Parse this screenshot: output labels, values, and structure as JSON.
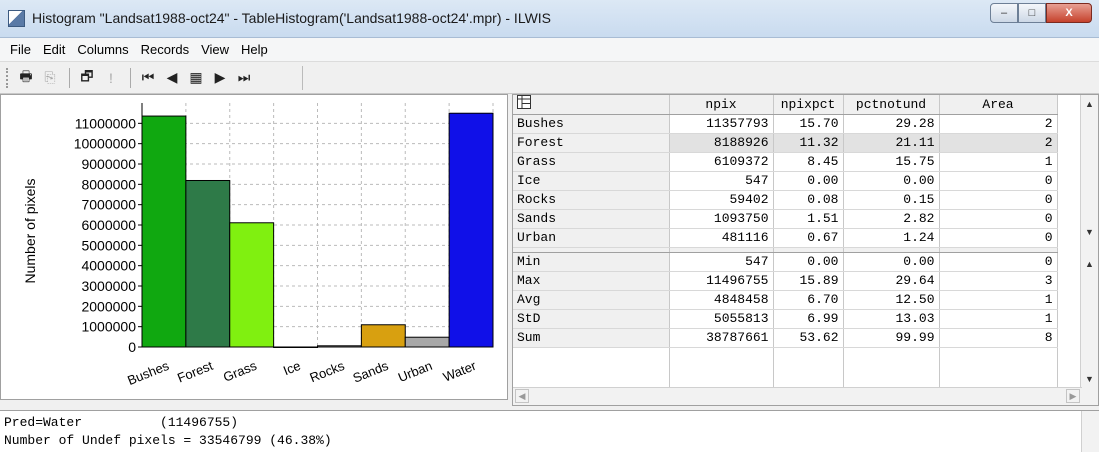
{
  "window": {
    "title": "Histogram \"Landsat1988-oct24\" - TableHistogram('Landsat1988-oct24'.mpr) - ILWIS",
    "minimize": "–",
    "maximize": "□",
    "close": "X"
  },
  "menu": [
    "File",
    "Edit",
    "Columns",
    "Records",
    "View",
    "Help"
  ],
  "toolbar": {
    "icons": [
      "print-icon",
      "copy-icon",
      "properties-icon",
      "info-icon",
      "first-record-icon",
      "previous-record-icon",
      "goto-record-icon",
      "next-record-icon",
      "last-record-icon"
    ],
    "glyphs": [
      "🖶",
      "⎘",
      "🗗",
      "!",
      "⏮",
      "◀",
      "▦",
      "▶",
      "⏭"
    ]
  },
  "chart_data": {
    "type": "bar",
    "categories": [
      "Bushes",
      "Forest",
      "Grass",
      "Ice",
      "Rocks",
      "Sands",
      "Urban",
      "Water"
    ],
    "values": [
      11357793,
      8188926,
      6109372,
      547,
      59402,
      1093750,
      481116,
      11496755
    ],
    "colors": [
      "#10a810",
      "#2e7a48",
      "#80f010",
      "#c0c0c0",
      "#c0c0c0",
      "#d8a010",
      "#a8a8a8",
      "#1010e8"
    ],
    "ylabel": "Number of pixels",
    "ylim": [
      0,
      12000000
    ],
    "yticks": [
      0,
      1000000,
      2000000,
      3000000,
      4000000,
      5000000,
      6000000,
      7000000,
      8000000,
      9000000,
      10000000,
      11000000
    ],
    "ytick_labels": [
      "0",
      "1000000",
      "2000000",
      "3000000",
      "4000000",
      "5000000",
      "6000000",
      "7000000",
      "8000000",
      "9000000",
      "10000000",
      "11000000"
    ],
    "grid": true
  },
  "table": {
    "corner_icon": "table-icon",
    "columns": [
      "npix",
      "npixpct",
      "pctnotund",
      "Area"
    ],
    "rows": [
      {
        "label": "Bushes",
        "npix": "11357793",
        "npixpct": "15.70",
        "pctnotund": "29.28",
        "area": "2"
      },
      {
        "label": "Forest",
        "npix": "8188926",
        "npixpct": "11.32",
        "pctnotund": "21.11",
        "area": "2"
      },
      {
        "label": "Grass",
        "npix": "6109372",
        "npixpct": "8.45",
        "pctnotund": "15.75",
        "area": "1"
      },
      {
        "label": "Ice",
        "npix": "547",
        "npixpct": "0.00",
        "pctnotund": "0.00",
        "area": "0"
      },
      {
        "label": "Rocks",
        "npix": "59402",
        "npixpct": "0.08",
        "pctnotund": "0.15",
        "area": "0"
      },
      {
        "label": "Sands",
        "npix": "1093750",
        "npixpct": "1.51",
        "pctnotund": "2.82",
        "area": "0"
      },
      {
        "label": "Urban",
        "npix": "481116",
        "npixpct": "0.67",
        "pctnotund": "1.24",
        "area": "0"
      }
    ],
    "selected_row": "Forest",
    "stats": [
      {
        "label": "Min",
        "npix": "547",
        "npixpct": "0.00",
        "pctnotund": "0.00",
        "area": "0"
      },
      {
        "label": "Max",
        "npix": "11496755",
        "npixpct": "15.89",
        "pctnotund": "29.64",
        "area": "3"
      },
      {
        "label": "Avg",
        "npix": "4848458",
        "npixpct": "6.70",
        "pctnotund": "12.50",
        "area": "1"
      },
      {
        "label": "StD",
        "npix": "5055813",
        "npixpct": "6.99",
        "pctnotund": "13.03",
        "area": "1"
      },
      {
        "label": "Sum",
        "npix": "38787661",
        "npixpct": "53.62",
        "pctnotund": "99.99",
        "area": "8"
      }
    ]
  },
  "status": {
    "line1": "Pred=Water          (11496755)",
    "line2": "Number of Undef pixels = 33546799 (46.38%)"
  }
}
